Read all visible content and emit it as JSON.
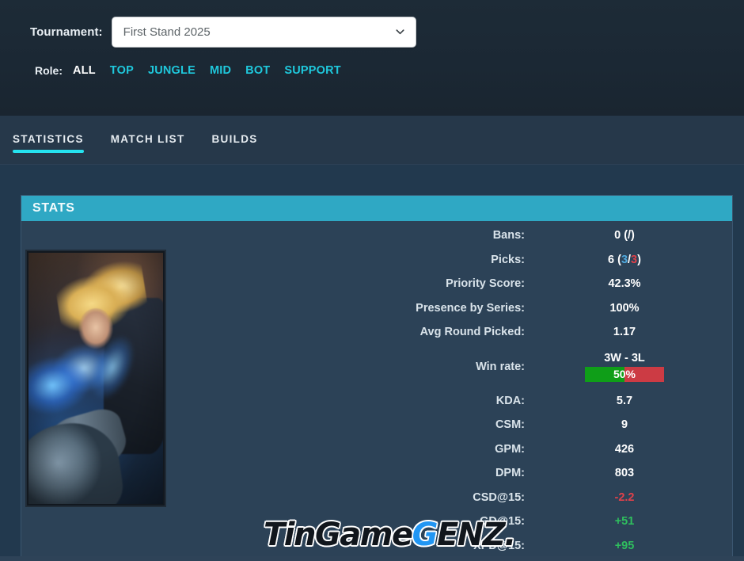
{
  "filters": {
    "tournament_label": "Tournament:",
    "tournament_value": "First Stand 2025",
    "tournament_placeholder": "First Stand 2025",
    "chevron_icon": "chevron-down-icon",
    "role_label": "Role:",
    "roles": [
      {
        "label": "ALL",
        "active": true
      },
      {
        "label": "TOP",
        "active": false
      },
      {
        "label": "JUNGLE",
        "active": false
      },
      {
        "label": "MID",
        "active": false
      },
      {
        "label": "BOT",
        "active": false
      },
      {
        "label": "SUPPORT",
        "active": false
      }
    ]
  },
  "tabs": [
    {
      "label": "STATISTICS",
      "active": true
    },
    {
      "label": "MATCH LIST",
      "active": false
    },
    {
      "label": "BUILDS",
      "active": false
    }
  ],
  "card": {
    "title": "STATS",
    "champion_art_alt": "champion-splash-art"
  },
  "stats": [
    {
      "label": "Bans:",
      "value": "0 (/)"
    },
    {
      "label": "Picks:",
      "value": "6 (3/3)",
      "parts": [
        {
          "text": "6 (",
          "color": ""
        },
        {
          "text": "3",
          "color": "blue"
        },
        {
          "text": "/",
          "color": ""
        },
        {
          "text": "3",
          "color": "red"
        },
        {
          "text": ")",
          "color": ""
        }
      ]
    },
    {
      "label": "Priority Score:",
      "value": "42.3%"
    },
    {
      "label": "Presence by Series:",
      "value": "100%"
    },
    {
      "label": "Avg Round Picked:",
      "value": "1.17"
    }
  ],
  "winrate": {
    "label": "Win rate:",
    "record": "3W - 3L",
    "percent_text": "50%",
    "percent_value": 50,
    "win_color": "#0f9e18",
    "loss_color": "#cc3b44"
  },
  "stats_lower": [
    {
      "label": "KDA:",
      "value": "5.7",
      "tone": ""
    },
    {
      "label": "CSM:",
      "value": "9",
      "tone": ""
    },
    {
      "label": "GPM:",
      "value": "426",
      "tone": ""
    },
    {
      "label": "DPM:",
      "value": "803",
      "tone": ""
    },
    {
      "label": "CSD@15:",
      "value": "-2.2",
      "tone": "neg"
    },
    {
      "label": "GD@15:",
      "value": "+51",
      "tone": "pos"
    },
    {
      "label": "XPD@15:",
      "value": "+95",
      "tone": "pos"
    }
  ],
  "watermark": {
    "part1": "TinGame",
    "part2": "G",
    "part3": "ENZ."
  },
  "colors": {
    "accent_cyan": "#25e3f0",
    "header_teal": "#2fa8c4",
    "role_link": "#1fc8dc",
    "positive": "#2fbf5e",
    "negative": "#e0414a",
    "pick_blue": "#4fa8dd",
    "pick_red": "#e0414a"
  }
}
